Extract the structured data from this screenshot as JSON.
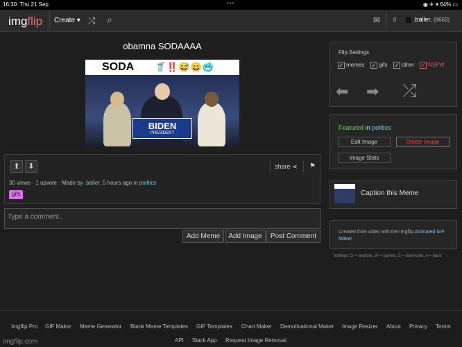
{
  "status_bar": {
    "time": "16:30",
    "date": "Thu 21 Sep",
    "dots": "•••",
    "battery": "64%"
  },
  "topnav": {
    "logo_main": "img",
    "logo_accent": "flip",
    "create_label": "Create ▾",
    "notifications": "0",
    "username": ".baller.",
    "points": "(8663)"
  },
  "meme": {
    "title": "obamna SODAAAA",
    "image_text": "SODA",
    "image_emoji": "🥤‼️😅😄🥶",
    "sign_text": "BIDEN",
    "sign_sub": "PRESIDENT"
  },
  "post": {
    "share_label": "share",
    "views": "30 views",
    "upvotes": "1 upvote",
    "made_by_prefix": "Made by",
    "author": ".baller.",
    "time_ago": "5 hours ago in",
    "stream": "politics",
    "tag": "gifs",
    "sep": "·"
  },
  "comment": {
    "placeholder": "Type a comment..",
    "add_meme": "Add Meme",
    "add_image": "Add Image",
    "post_comment": "Post Comment"
  },
  "flip_settings": {
    "title": "Flip Settings",
    "options": [
      {
        "label": "memes",
        "checked": true
      },
      {
        "label": "gifs",
        "checked": true
      },
      {
        "label": "other",
        "checked": true
      },
      {
        "label": "NSFW",
        "checked": true
      }
    ]
  },
  "featured": {
    "featured_label": "Featured",
    "in_label": "in",
    "stream": "politics",
    "edit_image": "Edit Image",
    "delete_image": "Delete Image",
    "image_stats": "Image Stats"
  },
  "caption": {
    "label": "Caption this Meme"
  },
  "created": {
    "text": "Created from video with the Imgflip",
    "link": "Animated GIF Maker"
  },
  "hotkeys": "hotkeys: D = random, W = upvote, S = downvote, A = back",
  "footer": {
    "links_row1": [
      "Imgflip Pro",
      "GIF Maker",
      "Meme Generator",
      "Blank Meme Templates",
      "GIF Templates",
      "Chart Maker",
      "Demotivational Maker",
      "Image Resizer",
      "About",
      "Privacy",
      "Terms"
    ],
    "links_row2": [
      "API",
      "Slack App",
      "Request Image Removal"
    ],
    "domain": "imgflip.com"
  },
  "colors": {
    "accent_link": "#7ec8e3",
    "nsfw": "#f05050",
    "delete": "#e04848",
    "tag": "#e36ff5",
    "featured": "#7fd07f"
  }
}
